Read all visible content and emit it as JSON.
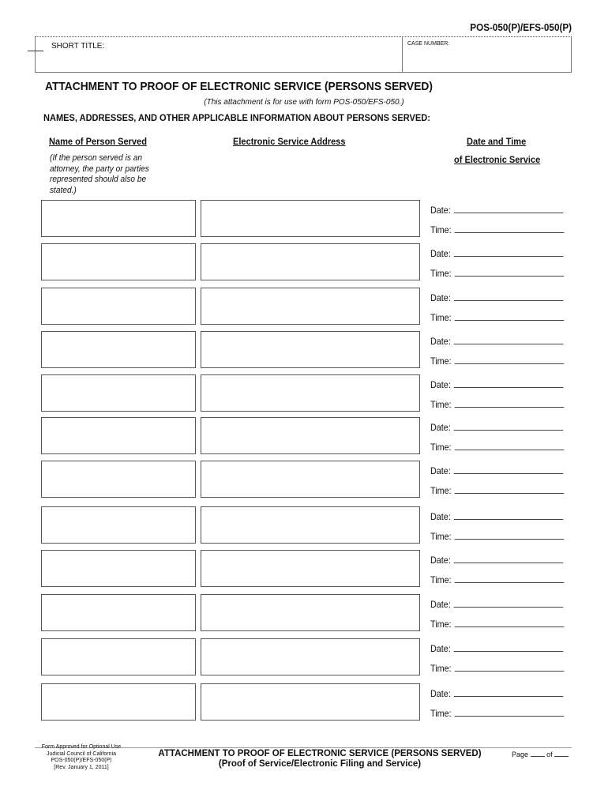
{
  "header": {
    "form_number": "POS-050(P)/EFS-050(P)",
    "short_title_label": "SHORT TITLE:",
    "case_number_label": "CASE NUMBER:"
  },
  "title": "ATTACHMENT TO PROOF OF ELECTRONIC SERVICE (PERSONS SERVED)",
  "subtitle": "(This attachment is for use with form POS-050/EFS-050.)",
  "section_heading": "NAMES, ADDRESSES, AND OTHER APPLICABLE INFORMATION ABOUT PERSONS SERVED:",
  "columns": {
    "name": "Name of Person Served",
    "address": "Electronic Service Address",
    "datetime_line1": "Date and Time",
    "datetime_line2": "of Electronic Service",
    "name_note": "(If the person served is an attorney, the party or parties represented should also be stated.)"
  },
  "entry_labels": {
    "date": "Date:",
    "time": "Time:"
  },
  "entries": [
    {
      "name": "",
      "address": "",
      "date": "",
      "time": ""
    },
    {
      "name": "",
      "address": "",
      "date": "",
      "time": ""
    },
    {
      "name": "",
      "address": "",
      "date": "",
      "time": ""
    },
    {
      "name": "",
      "address": "",
      "date": "",
      "time": ""
    },
    {
      "name": "",
      "address": "",
      "date": "",
      "time": ""
    },
    {
      "name": "",
      "address": "",
      "date": "",
      "time": ""
    },
    {
      "name": "",
      "address": "",
      "date": "",
      "time": ""
    },
    {
      "name": "",
      "address": "",
      "date": "",
      "time": ""
    },
    {
      "name": "",
      "address": "",
      "date": "",
      "time": ""
    },
    {
      "name": "",
      "address": "",
      "date": "",
      "time": ""
    },
    {
      "name": "",
      "address": "",
      "date": "",
      "time": ""
    },
    {
      "name": "",
      "address": "",
      "date": "",
      "time": ""
    }
  ],
  "footer": {
    "left_lines": [
      "Form Approved for Optional Use",
      "Judicial Council of California",
      "POS-050(P)/EFS-050(P)",
      "[Rev. January 1,  2011]"
    ],
    "title_line1": "ATTACHMENT TO PROOF OF ELECTRONIC SERVICE (PERSONS SERVED)",
    "title_line2": "(Proof of Service/Electronic Filing and Service)",
    "page_label": "Page",
    "of_label": "of"
  }
}
